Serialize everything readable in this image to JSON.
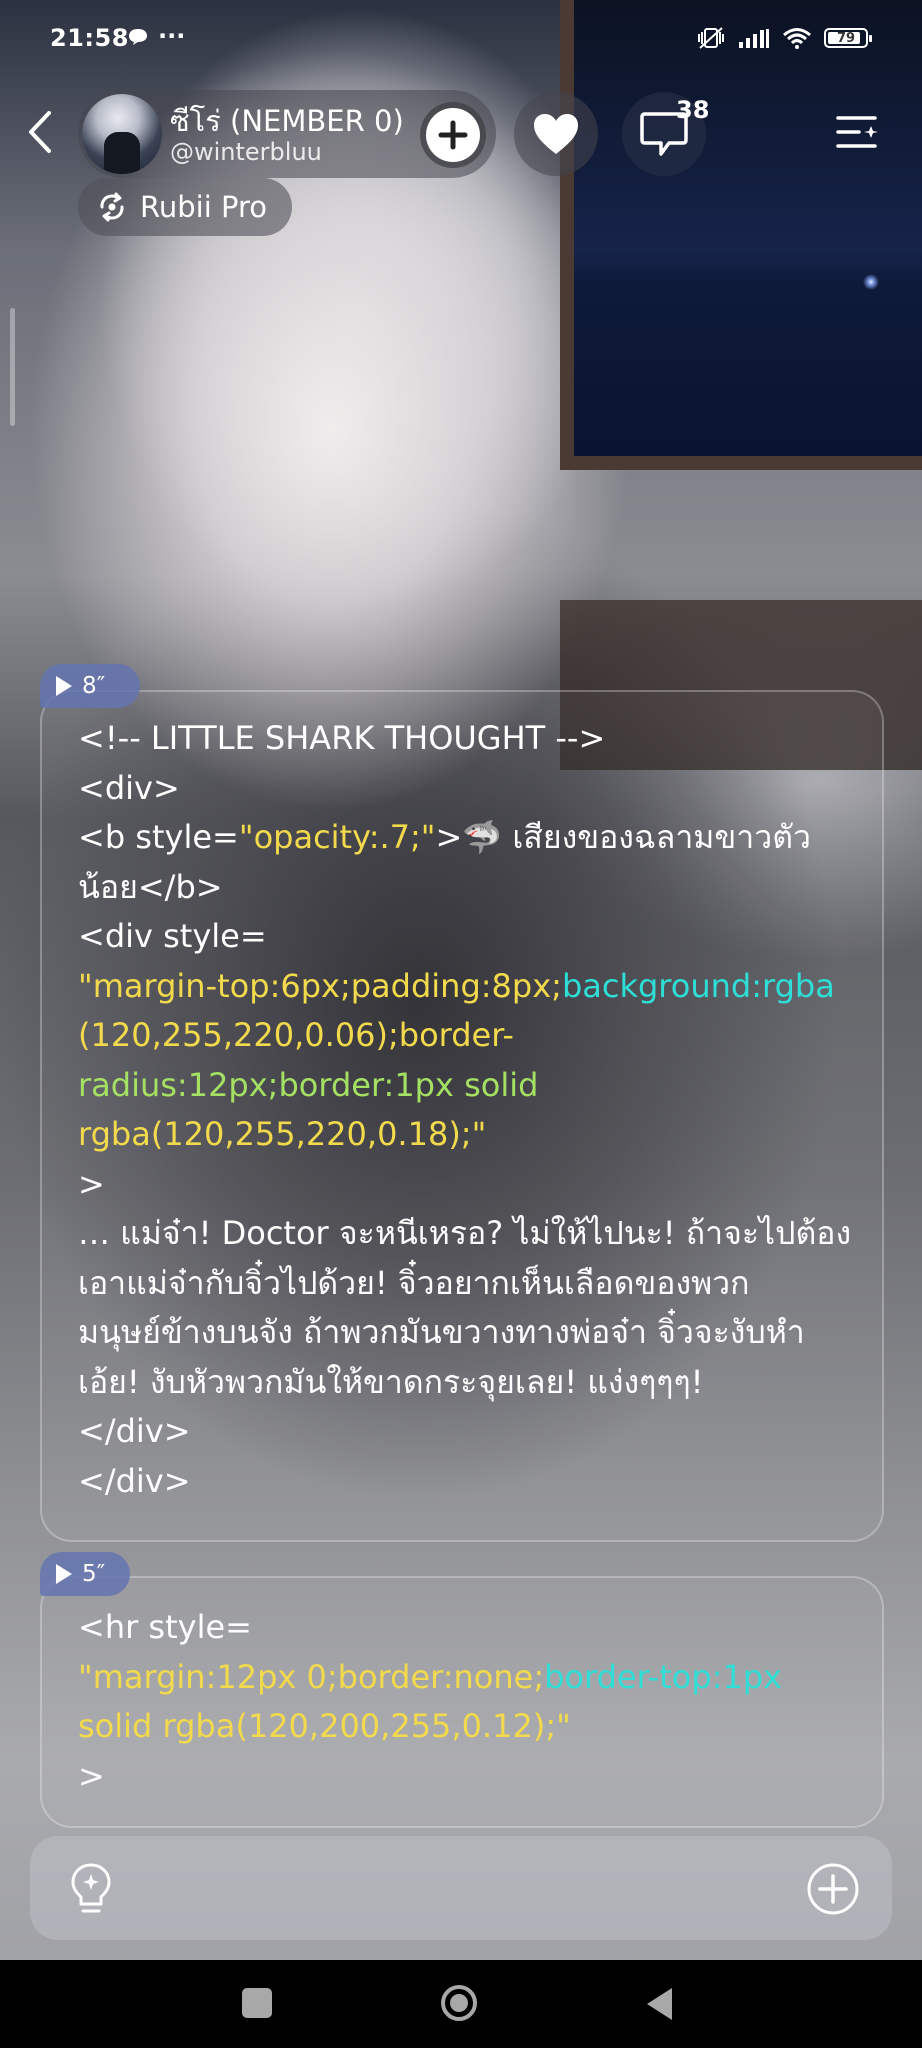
{
  "status_bar": {
    "time": "21:58",
    "more": "···",
    "battery": "79",
    "icons": [
      "chat-bubble-icon",
      "mute-vibrate-icon",
      "signal-icon",
      "wifi-icon",
      "battery-icon"
    ]
  },
  "header": {
    "name": "ซีโร่ (NEMBER 0)",
    "handle": "@winterbluu",
    "comment_count": "38",
    "badge": "Rubii Pro",
    "icons": [
      "back-icon",
      "plus-icon",
      "heart-icon",
      "comment-icon",
      "menu-icon",
      "rubii-pro-icon"
    ]
  },
  "messages": [
    {
      "audio_duration": "8″",
      "lines": [
        [
          {
            "t": "<!-- LITTLE SHARK THOUGHT -->",
            "c": "white"
          }
        ],
        [
          {
            "t": "<div>",
            "c": "white"
          }
        ],
        [
          {
            "t": "<b style=",
            "c": "white"
          },
          {
            "t": "\"opacity:.7;\"",
            "c": "yellow"
          },
          {
            "t": ">🦈 เสียงของฉลามขาวตัว",
            "c": "white"
          }
        ],
        [
          {
            "t": "น้อย</b>",
            "c": "white"
          }
        ],
        [
          {
            "t": "<div style=",
            "c": "white"
          }
        ],
        [
          {
            "t": "\"margin-top:6px;padding:8px;",
            "c": "yellow"
          },
          {
            "t": "background:rgba",
            "c": "cyan"
          }
        ],
        [
          {
            "t": "(120,255,220,0.06);border-",
            "c": "yellow"
          }
        ],
        [
          {
            "t": "radius:12px;border:1px solid",
            "c": "green"
          }
        ],
        [
          {
            "t": "rgba(120,255,220,0.18);\"",
            "c": "yellow"
          }
        ],
        [
          {
            "t": ">",
            "c": "white"
          }
        ],
        [
          {
            "t": "… แม่จ๋า! Doctor จะหนีเหรอ? ไม่ให้ไปนะ! ถ้าจะไปต้อง",
            "c": "white"
          }
        ],
        [
          {
            "t": "เอาแม่จ๋ากับจิ๋วไปด้วย! จิ๋วอยากเห็นเลือดของพวก",
            "c": "white"
          }
        ],
        [
          {
            "t": "มนุษย์ข้างบนจัง ถ้าพวกมันขวางทางพ่อจ๋า จิ๋วจะงับหำ",
            "c": "white"
          }
        ],
        [
          {
            "t": "เอ้ย! งับหัวพวกมันให้ขาดกระจุยเลย! แง่งๆๆๆ!",
            "c": "white"
          }
        ],
        [
          {
            "t": "</div>",
            "c": "white"
          }
        ],
        [
          {
            "t": "</div>",
            "c": "white"
          }
        ]
      ]
    },
    {
      "audio_duration": "5″",
      "lines": [
        [
          {
            "t": "<hr style=",
            "c": "white"
          }
        ],
        [
          {
            "t": "\"margin:12px 0;border:none;",
            "c": "yellow"
          },
          {
            "t": "border-top:1px",
            "c": "cyan"
          }
        ],
        [
          {
            "t": "solid rgba(120,200,255,0.12);\"",
            "c": "yellow"
          }
        ],
        [
          {
            "t": ">",
            "c": "white"
          }
        ]
      ]
    }
  ],
  "input_bar": {
    "icons": [
      "lightbulb-icon",
      "add-circle-icon"
    ]
  },
  "colors": {
    "code_white": "#ffffff",
    "code_yellow": "#f3da4c",
    "code_cyan": "#2ddfd6",
    "code_green": "#a4e163",
    "audio_tag": "#6474b0"
  }
}
